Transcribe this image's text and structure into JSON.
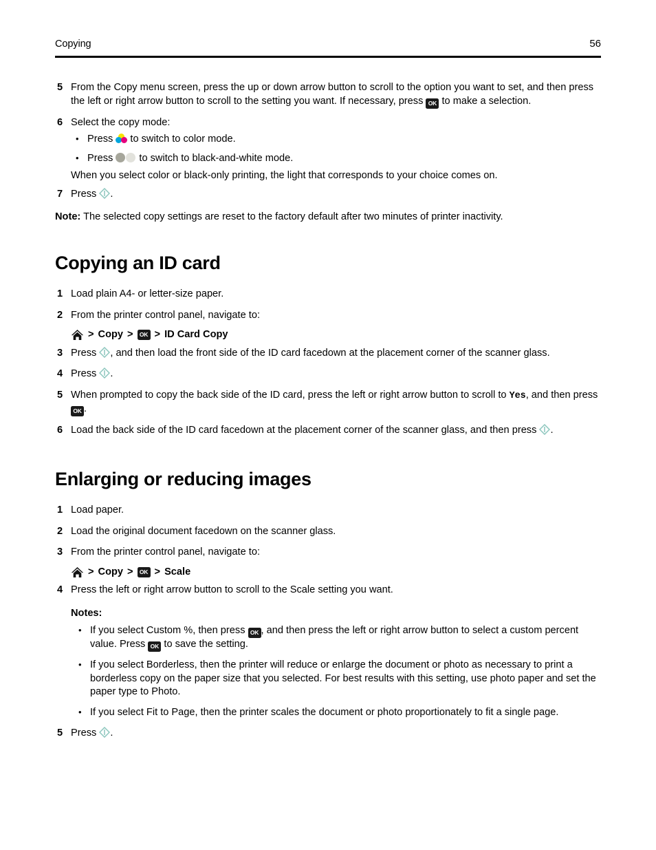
{
  "header": {
    "title": "Copying",
    "page_number": "56"
  },
  "icons": {
    "ok_key_label": "OK",
    "ok_key_name": "ok-button-icon",
    "start_key_name": "start-button-icon",
    "home_key_name": "home-icon",
    "color_key_name": "color-mode-icon",
    "bw_key_name": "black-and-white-mode-icon"
  },
  "colors": {
    "start_key_stroke": "#8cc6bd",
    "ok_key_background": "#1a1a1a",
    "color_yellow": "#f5e400",
    "color_cyan": "#00a5dd",
    "color_magenta": "#e5007e",
    "bw_dark": "#a6a69b",
    "bw_light": "#e2e2dc",
    "rule": "#000000"
  },
  "continued_steps": [
    {
      "number": "5",
      "text_before_icon": "From the Copy menu screen, press the up or down arrow button to scroll to the option you want to set, and then press the left or right arrow button to scroll to the setting you want. If necessary, press ",
      "text_after_icon": " to make a selection."
    },
    {
      "number": "6",
      "text": "Select the copy mode:",
      "bullets": [
        {
          "before": "Press ",
          "after": " to switch to color mode.",
          "icon": "color"
        },
        {
          "before": "Press ",
          "after": " to switch to black-and-white mode.",
          "icon": "bw"
        }
      ],
      "followup": "When you select color or black-only printing, the light that corresponds to your choice comes on."
    },
    {
      "number": "7",
      "text_before_icon": "Press ",
      "text_after_icon": "."
    }
  ],
  "note": {
    "label": "Note:",
    "text": " The selected copy settings are reset to the factory default after two minutes of printer inactivity."
  },
  "id_card_section": {
    "heading": "Copying an ID card",
    "steps": [
      {
        "number": "1",
        "text": "Load plain A4- or letter-size paper."
      },
      {
        "number": "2",
        "text": "From the printer control panel, navigate to:"
      },
      {
        "number": "3",
        "text_before_icon": "Press ",
        "text_after_icon": ", and then load the front side of the ID card facedown at the placement corner of the scanner glass."
      },
      {
        "number": "4",
        "text_before_icon": "Press ",
        "text_after_icon": "."
      },
      {
        "number": "5",
        "part1": "When prompted to copy the back side of the ID card, press the left or right arrow button to scroll to ",
        "mono": "Yes",
        "part2": ", and then press ",
        "part3": "."
      },
      {
        "number": "6",
        "text_before_icon": "Load the back side of the ID card facedown at the placement corner of the scanner glass, and then press ",
        "text_after_icon": "."
      }
    ],
    "breadcrumb": {
      "separator": ">",
      "copy_label": "Copy",
      "destination_label": "ID Card Copy"
    }
  },
  "scale_section": {
    "heading": "Enlarging or reducing images",
    "steps": [
      {
        "number": "1",
        "text": "Load paper."
      },
      {
        "number": "2",
        "text": "Load the original document facedown on the scanner glass."
      },
      {
        "number": "3",
        "text": "From the printer control panel, navigate to:"
      },
      {
        "number": "4",
        "text": "Press the left or right arrow button to scroll to the Scale setting you want."
      },
      {
        "number": "5",
        "text_before_icon": "Press ",
        "text_after_icon": "."
      }
    ],
    "breadcrumb": {
      "separator": ">",
      "copy_label": "Copy",
      "destination_label": "Scale"
    },
    "notes_label": "Notes:",
    "notes": [
      {
        "part1": "If you select Custom %, then press ",
        "part2": ", and then press the left or right arrow button to select a custom percent value. Press ",
        "part3": " to save the setting."
      },
      {
        "text": "If you select Borderless, then the printer will reduce or enlarge the document or photo as necessary to print a borderless copy on the paper size that you selected. For best results with this setting, use photo paper and set the paper type to Photo."
      },
      {
        "text": "If you select Fit to Page, then the printer scales the document or photo proportionately to fit a single page."
      }
    ]
  }
}
